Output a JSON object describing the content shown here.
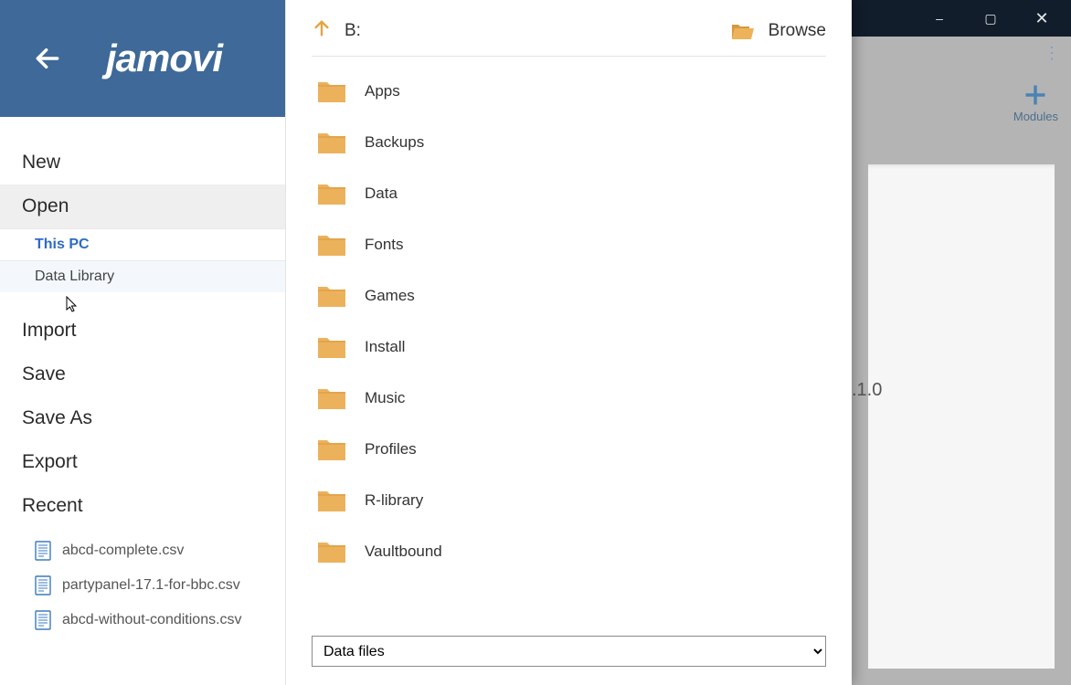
{
  "window": {
    "minimize": "–",
    "maximize": "▢",
    "close": "✕"
  },
  "app_back": {
    "modules_label": "Modules",
    "version_fragment": ".1.0"
  },
  "header": {
    "logo": "jamovi"
  },
  "menu": {
    "items": [
      {
        "label": "New"
      },
      {
        "label": "Open",
        "active": true,
        "sub": [
          {
            "label": "This PC",
            "selected": true
          },
          {
            "label": "Data Library",
            "hover": true
          }
        ]
      },
      {
        "label": "Import"
      },
      {
        "label": "Save"
      },
      {
        "label": "Save As"
      },
      {
        "label": "Export"
      },
      {
        "label": "Recent",
        "recent": [
          "abcd-complete.csv",
          "partypanel-17.1-for-bbc.csv",
          "abcd-without-conditions.csv"
        ]
      }
    ]
  },
  "browser": {
    "path": "B:",
    "browse_label": "Browse",
    "folders": [
      "Apps",
      "Backups",
      "Data",
      "Fonts",
      "Games",
      "Install",
      "Music",
      "Profiles",
      "R-library",
      "Vaultbound"
    ],
    "filter": "Data files"
  }
}
